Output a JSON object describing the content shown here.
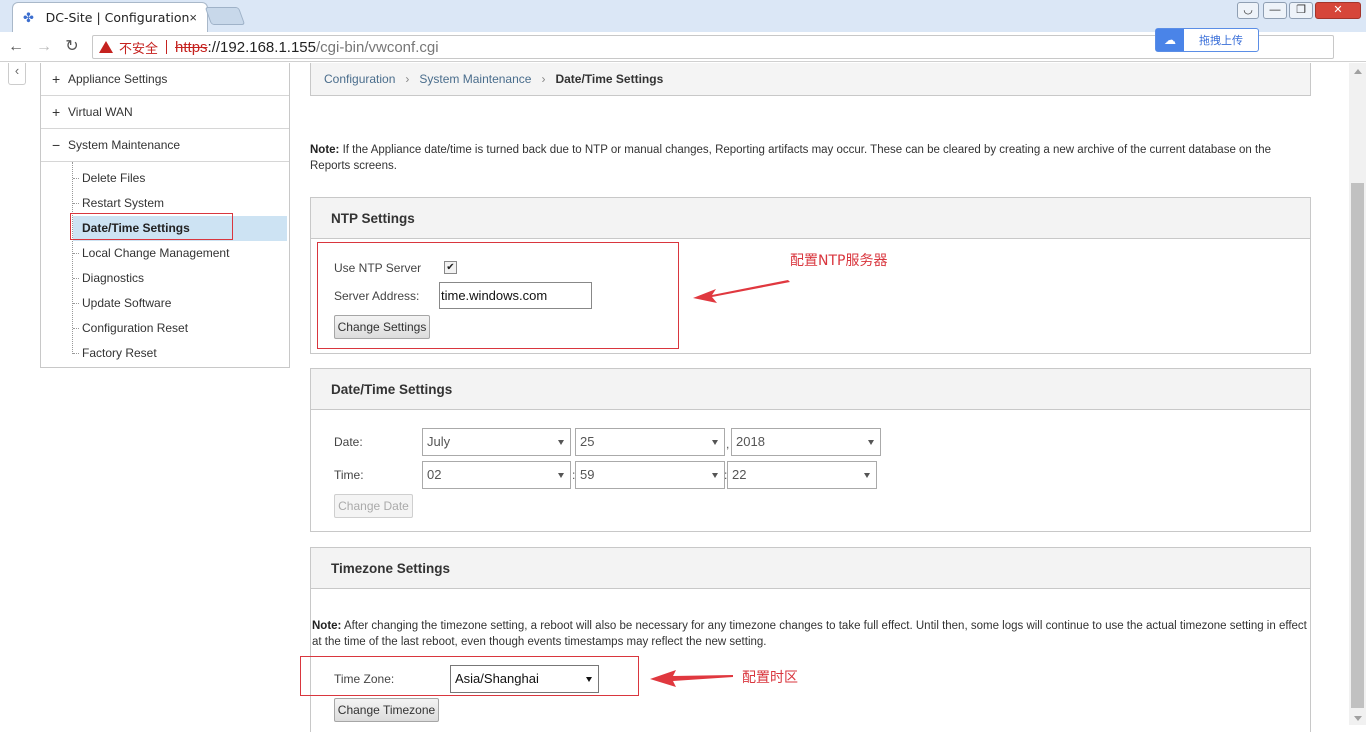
{
  "browser": {
    "tab_title": "DC-Site | Configuration",
    "tab_close": "×",
    "win_minimize": "—",
    "win_restore": "❐",
    "win_close": "✕",
    "security_label": "不安全",
    "url_protocol": "https",
    "url_host": "://192.168.1.155",
    "url_path": "/cgi-bin/vwconf.cgi",
    "upload_label": "拖拽上传"
  },
  "sidebar": {
    "sections": [
      {
        "toggle": "+",
        "label": "Appliance Settings"
      },
      {
        "toggle": "+",
        "label": "Virtual WAN"
      },
      {
        "toggle": "−",
        "label": "System Maintenance"
      }
    ],
    "items": [
      {
        "label": "Delete Files"
      },
      {
        "label": "Restart System"
      },
      {
        "label": "Date/Time Settings",
        "active": true
      },
      {
        "label": "Local Change Management"
      },
      {
        "label": "Diagnostics"
      },
      {
        "label": "Update Software"
      },
      {
        "label": "Configuration Reset"
      },
      {
        "label": "Factory Reset"
      }
    ]
  },
  "breadcrumb": [
    "Configuration",
    "System Maintenance",
    "Date/Time Settings"
  ],
  "note_top": {
    "label": "Note:",
    "text": " If the Appliance date/time is turned back due to NTP or manual changes, Reporting artifacts may occur. These can be cleared by creating a new archive of the current database on the Reports screens."
  },
  "ntp": {
    "title": "NTP Settings",
    "use_ntp_label": "Use NTP Server",
    "use_ntp_checked": true,
    "check_mark": "✔",
    "server_label": "Server Address:",
    "server_value": "time.windows.com",
    "button": "Change Settings"
  },
  "datetime": {
    "title": "Date/Time Settings",
    "date_label": "Date:",
    "time_label": "Time:",
    "month": "July",
    "day": "25",
    "year": "2018",
    "hour": "02",
    "minute": "59",
    "second": "22",
    "date_sep": ",",
    "time_sep": ":",
    "button": "Change Date"
  },
  "timezone": {
    "title": "Timezone Settings",
    "note_label": "Note:",
    "note_text": " After changing the timezone setting, a reboot will also be necessary for any timezone changes to take full effect. Until then, some logs will continue to use the actual timezone setting in effect at the time of the last reboot, even though events timestamps may reflect the new setting.",
    "label": "Time Zone:",
    "value": "Asia/Shanghai",
    "button": "Change Timezone"
  },
  "annotations": {
    "ntp": "配置NTP服务器",
    "timezone": "配置时区"
  },
  "colors": {
    "annotation_red": "#d9363e",
    "active_item_bg": "#cde3f3",
    "link_blue": "#4a6d8c"
  }
}
